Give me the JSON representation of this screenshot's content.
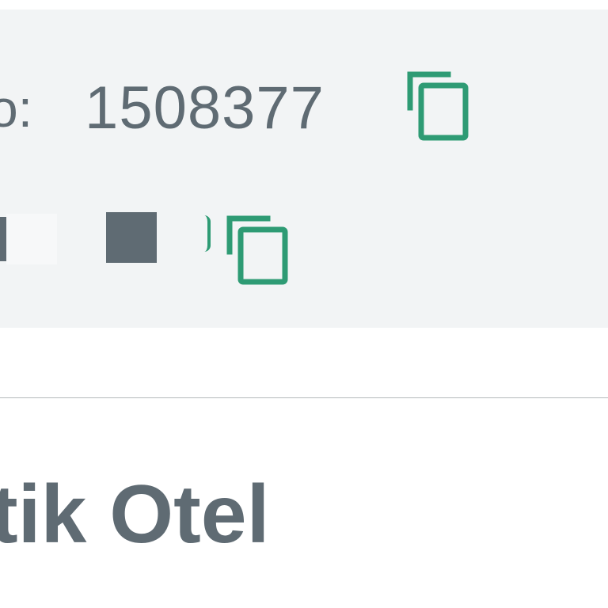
{
  "info_panel": {
    "reservation_row": {
      "label": "o:",
      "value": "1508377"
    },
    "second_row": {
      "masked": true
    }
  },
  "hotel": {
    "name": "tik Otel"
  },
  "icons": {
    "copy": "copy-icon"
  },
  "colors": {
    "accent": "#2e9b74",
    "text": "#5f6b73",
    "panel_bg": "#f2f4f5",
    "divider": "#b5b9bc"
  }
}
